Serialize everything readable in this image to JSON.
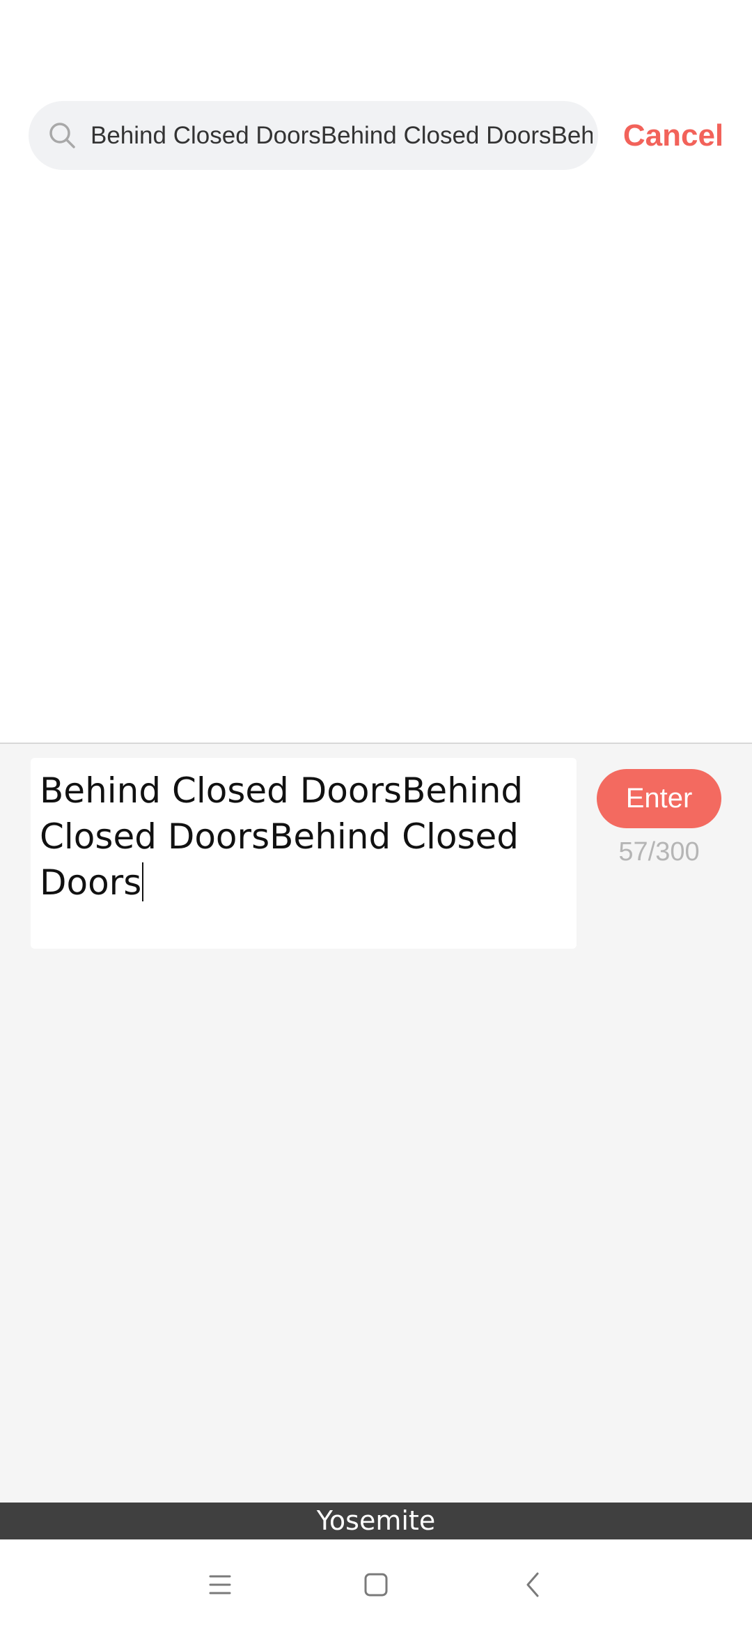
{
  "search": {
    "query": "Behind Closed DoorsBehind Closed DoorsBehind Closed Doors",
    "cancel_label": "Cancel"
  },
  "editor": {
    "text": "Behind Closed DoorsBehind Closed DoorsBehind Closed Doors",
    "enter_label": "Enter",
    "char_count": "57/300"
  },
  "label_bar": {
    "text": "Yosemite"
  },
  "nav": {
    "icons": [
      "menu-icon",
      "home-square-icon",
      "back-chevron-icon"
    ]
  },
  "colors": {
    "accent": "#f2625a",
    "enter_button": "#f36a60",
    "panel_bg": "#f5f5f5",
    "search_bg": "#f1f2f4",
    "label_bar_bg": "#404040"
  }
}
